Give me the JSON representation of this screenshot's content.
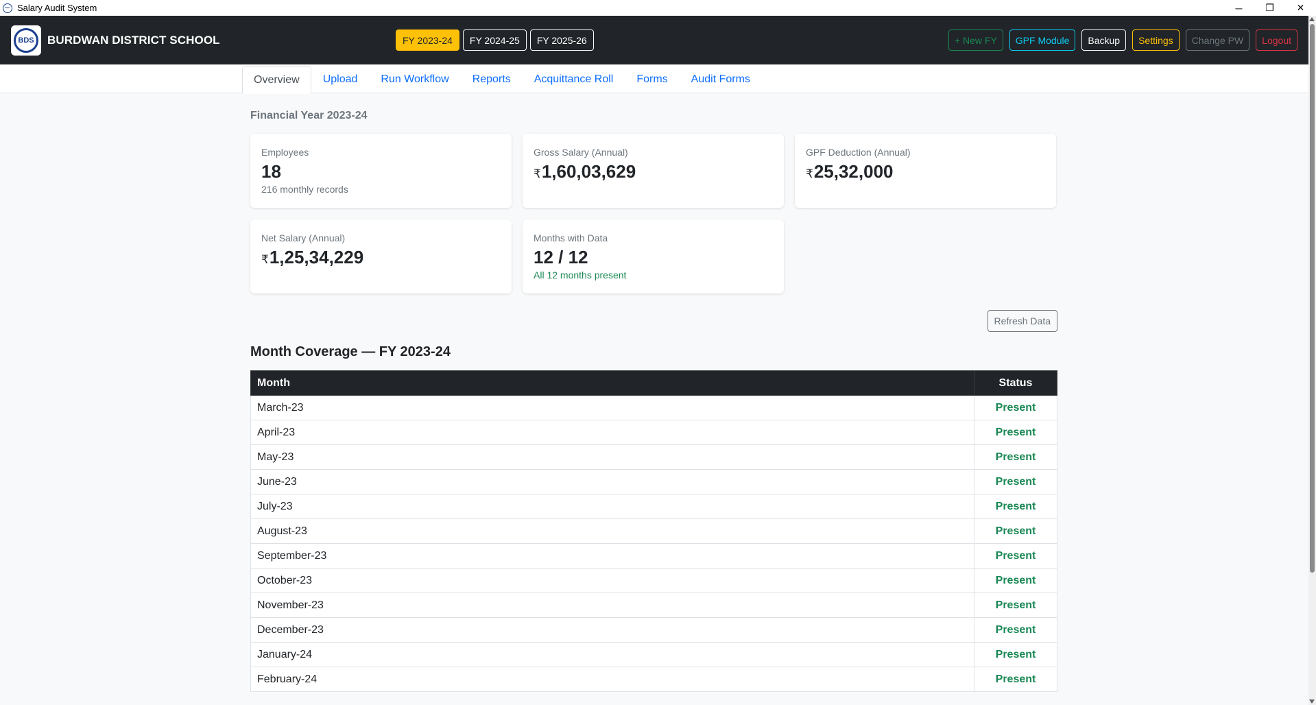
{
  "window": {
    "title": "Salary Audit System",
    "minimize": "─",
    "restore": "❐",
    "close": "✕"
  },
  "navbar": {
    "logo_text": "BDS",
    "brand": "BURDWAN DISTRICT SCHOOL",
    "fy_buttons": [
      "FY 2023-24",
      "FY 2024-25",
      "FY 2025-26"
    ],
    "active_fy": "FY 2023-24",
    "actions": {
      "new_fy": "+ New FY",
      "gpf_module": "GPF Module",
      "backup": "Backup",
      "settings": "Settings",
      "change_pw": "Change PW",
      "logout": "Logout"
    }
  },
  "tabs": [
    "Overview",
    "Upload",
    "Run Workflow",
    "Reports",
    "Acquittance Roll",
    "Forms",
    "Audit Forms"
  ],
  "active_tab": "Overview",
  "overview": {
    "heading": "Financial Year 2023-24",
    "currency_symbol": "₹",
    "cards": {
      "employees": {
        "label": "Employees",
        "value": "18",
        "sub": "216 monthly records"
      },
      "gross": {
        "label": "Gross Salary (Annual)",
        "value": "1,60,03,629"
      },
      "gpf": {
        "label": "GPF Deduction (Annual)",
        "value": "25,32,000"
      },
      "net": {
        "label": "Net Salary (Annual)",
        "value": "1,25,34,229"
      },
      "months": {
        "label": "Months with Data",
        "value": "12 / 12",
        "sub": "All 12 months present"
      }
    },
    "refresh_label": "Refresh Data",
    "coverage_title": "Month Coverage — FY 2023-24",
    "table": {
      "headers": {
        "month": "Month",
        "status": "Status"
      },
      "rows": [
        {
          "month": "March-23",
          "status": "Present"
        },
        {
          "month": "April-23",
          "status": "Present"
        },
        {
          "month": "May-23",
          "status": "Present"
        },
        {
          "month": "June-23",
          "status": "Present"
        },
        {
          "month": "July-23",
          "status": "Present"
        },
        {
          "month": "August-23",
          "status": "Present"
        },
        {
          "month": "September-23",
          "status": "Present"
        },
        {
          "month": "October-23",
          "status": "Present"
        },
        {
          "month": "November-23",
          "status": "Present"
        },
        {
          "month": "December-23",
          "status": "Present"
        },
        {
          "month": "January-24",
          "status": "Present"
        },
        {
          "month": "February-24",
          "status": "Present"
        }
      ]
    }
  },
  "colors": {
    "navbar_bg": "#212529",
    "active_fy": "#ffc107",
    "link": "#0d6efd",
    "success": "#198754"
  }
}
